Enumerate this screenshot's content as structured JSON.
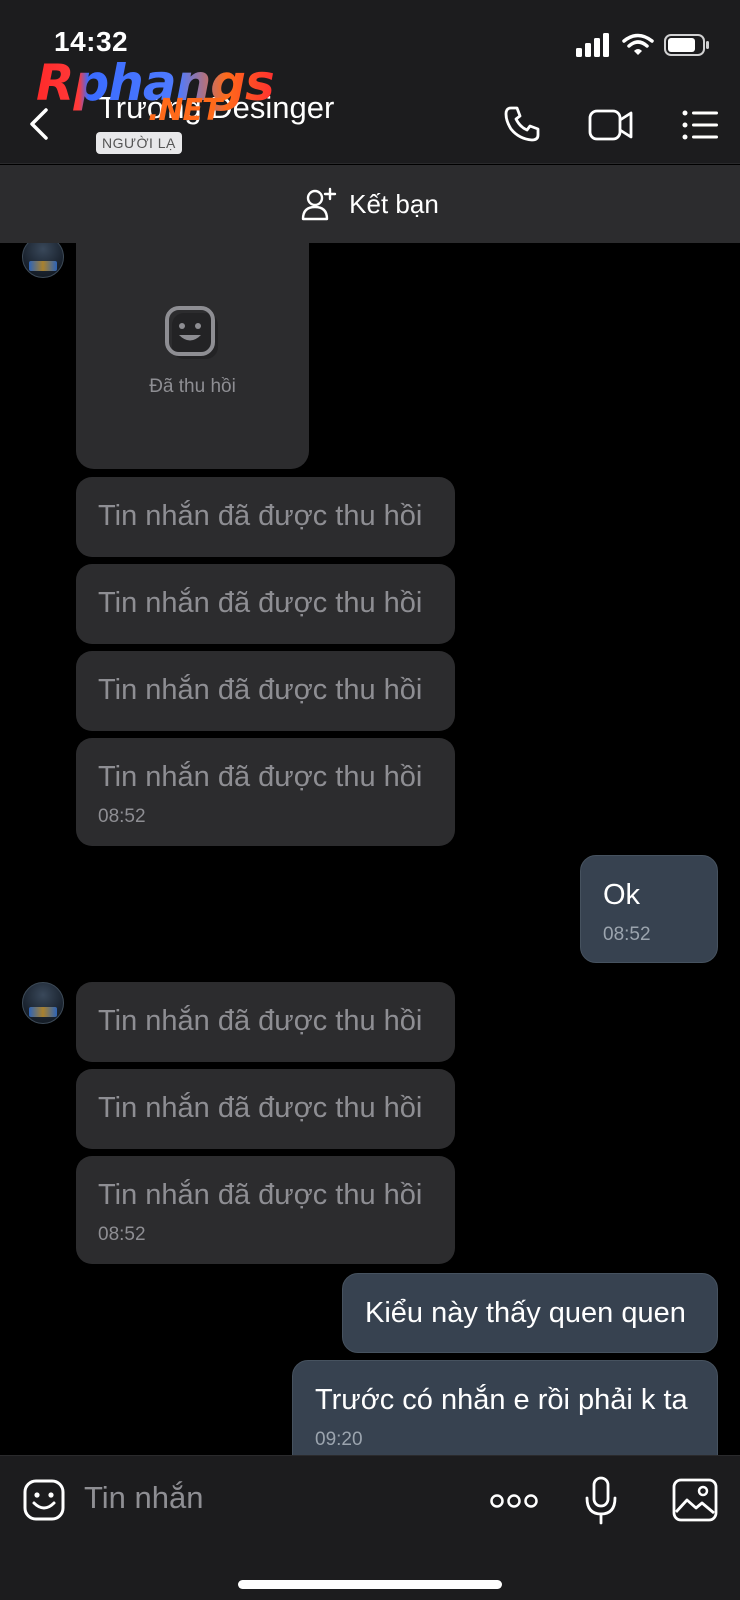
{
  "status_bar": {
    "time": "14:32"
  },
  "watermark": {
    "text": "Rphangs",
    "suffix": ".NET"
  },
  "header": {
    "contact_name": "Trường Desinger",
    "stranger_badge": "NGƯỜI LẠ",
    "icons": [
      "back-chevron-icon",
      "phone-icon",
      "video-call-icon",
      "menu-list-icon"
    ]
  },
  "friend_bar": {
    "label": "Kết bạn",
    "icon": "add-friend-icon"
  },
  "messages": [
    {
      "side": "incoming",
      "type": "media-revoked",
      "label": "Đã thu hồi"
    },
    {
      "side": "incoming",
      "text": "Tin nhắn đã được thu hồi"
    },
    {
      "side": "incoming",
      "text": "Tin nhắn đã được thu hồi"
    },
    {
      "side": "incoming",
      "text": "Tin nhắn đã được thu hồi"
    },
    {
      "side": "incoming",
      "text": "Tin nhắn đã được thu hồi",
      "time": "08:52"
    },
    {
      "side": "outgoing",
      "text": "Ok",
      "time": "08:52"
    },
    {
      "side": "incoming",
      "text": "Tin nhắn đã được thu hồi"
    },
    {
      "side": "incoming",
      "text": "Tin nhắn đã được thu hồi"
    },
    {
      "side": "incoming",
      "text": "Tin nhắn đã được thu hồi",
      "time": "08:52"
    },
    {
      "side": "outgoing",
      "text": "Kiểu này thấy quen quen"
    },
    {
      "side": "outgoing",
      "text": "Trước có nhắn e rồi phải k ta",
      "time": "09:20"
    }
  ],
  "input_bar": {
    "placeholder": "Tin nhắn",
    "icons": [
      "sticker-icon",
      "more-options-icon",
      "microphone-icon",
      "image-gallery-icon"
    ]
  },
  "colors": {
    "bar_bg": "#1c1c1e",
    "incoming_bubble": "#2c2c2e",
    "outgoing_bubble": "#374250",
    "muted_text": "#8e8e93"
  }
}
